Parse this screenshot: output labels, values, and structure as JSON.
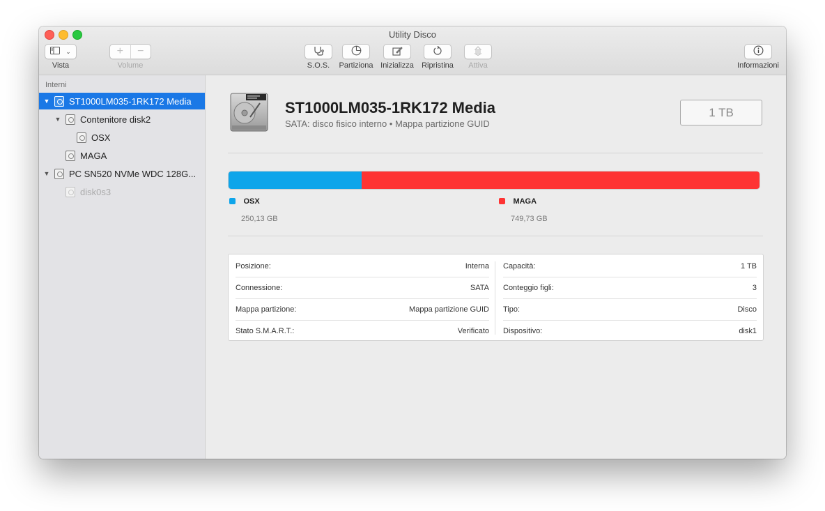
{
  "window": {
    "title": "Utility Disco"
  },
  "toolbar": {
    "view_label": "Vista",
    "volume_label": "Volume",
    "volume_add": "+",
    "volume_remove": "−",
    "sos_label": "S.O.S.",
    "partition_label": "Partiziona",
    "erase_label": "Inizializza",
    "restore_label": "Ripristina",
    "mount_label": "Attiva",
    "info_label": "Informazioni"
  },
  "sidebar": {
    "heading": "Interni",
    "items": [
      {
        "label": "ST1000LM035-1RK172 Media",
        "disclosure": "▼"
      },
      {
        "label": "Contenitore disk2",
        "disclosure": "▼"
      },
      {
        "label": "OSX"
      },
      {
        "label": "MAGA"
      },
      {
        "label": "PC SN520 NVMe WDC 128G...",
        "disclosure": "▼"
      },
      {
        "label": "disk0s3"
      }
    ]
  },
  "disk": {
    "title": "ST1000LM035-1RK172 Media",
    "subtitle": "SATA: disco fisico interno • Mappa partizione GUID",
    "capacity": "1 TB"
  },
  "partitions": [
    {
      "name": "OSX",
      "size": "250,13 GB",
      "color": "#0ea5ea",
      "fraction": 0.2502
    },
    {
      "name": "MAGA",
      "size": "749,73 GB",
      "color": "#fe3333",
      "fraction": 0.7498
    }
  ],
  "info": {
    "left": [
      {
        "key": "Posizione:",
        "value": "Interna"
      },
      {
        "key": "Connessione:",
        "value": "SATA"
      },
      {
        "key": "Mappa partizione:",
        "value": "Mappa partizione GUID"
      },
      {
        "key": "Stato S.M.A.R.T.:",
        "value": "Verificato"
      }
    ],
    "right": [
      {
        "key": "Capacità:",
        "value": "1 TB"
      },
      {
        "key": "Conteggio figli:",
        "value": "3"
      },
      {
        "key": "Tipo:",
        "value": "Disco"
      },
      {
        "key": "Dispositivo:",
        "value": "disk1"
      }
    ]
  },
  "colors": {
    "selection": "#1a78e6",
    "close": "#fe5f57",
    "minimize": "#febc2e",
    "zoom": "#28c840"
  }
}
